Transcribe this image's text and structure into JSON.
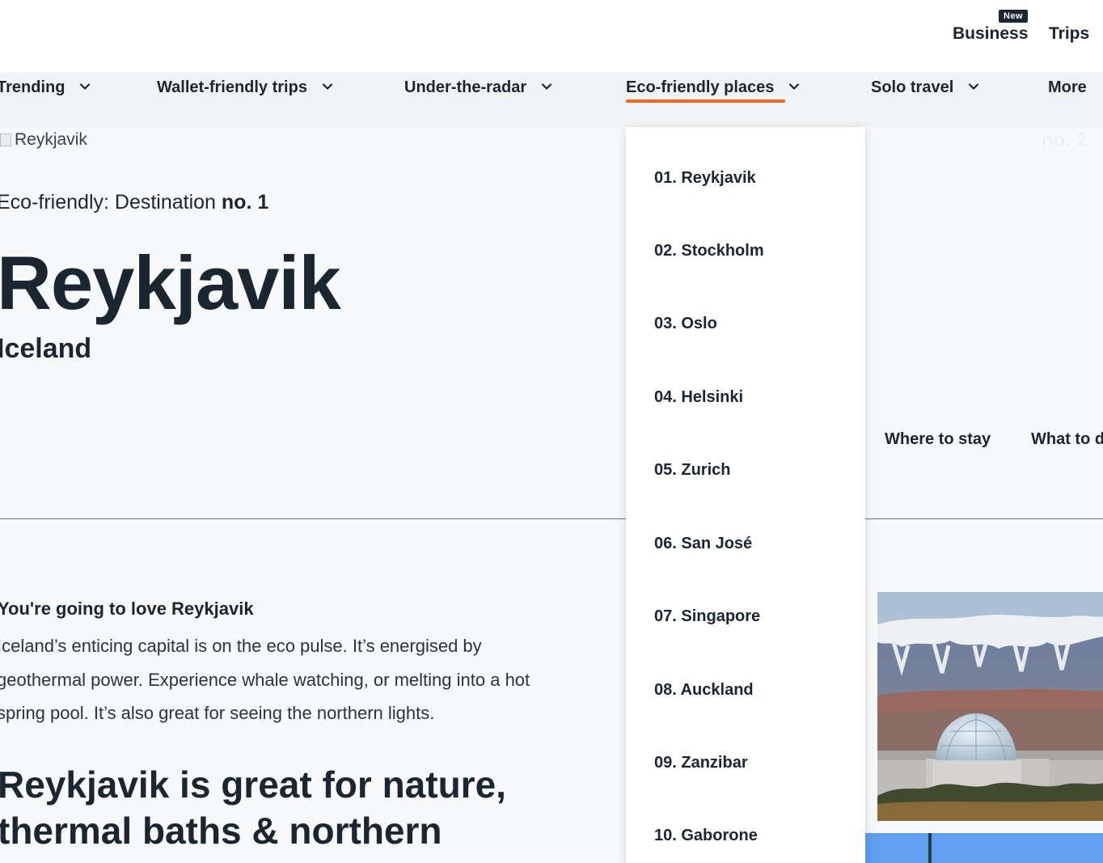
{
  "header": {
    "new_badge": "New",
    "business": "Business",
    "trips": "Trips"
  },
  "nav": {
    "items": [
      {
        "label": "Trending",
        "has_dropdown": true
      },
      {
        "label": "Wallet-friendly trips",
        "has_dropdown": true
      },
      {
        "label": "Under-the-radar",
        "has_dropdown": true
      },
      {
        "label": "Eco-friendly places",
        "has_dropdown": true,
        "active": true
      },
      {
        "label": "Solo travel",
        "has_dropdown": true
      },
      {
        "label": "More",
        "has_dropdown": false
      }
    ],
    "accent_color": "#f26722"
  },
  "dropdown": {
    "items": [
      "01. Reykjavik",
      "02. Stockholm",
      "03. Oslo",
      "04. Helsinki",
      "05. Zurich",
      "06. San José",
      "07. Singapore",
      "08. Auckland",
      "09. Zanzibar",
      "10. Gaborone"
    ]
  },
  "hero": {
    "image_alt": "Reykjavik",
    "eyebrow_prefix": "Eco-friendly: Destination ",
    "eyebrow_bold": "no. 1",
    "title": "Reykjavik",
    "subtitle": "Iceland",
    "next_label": "no. 2",
    "links": {
      "where_to_stay": "Where to stay",
      "what_to_do": "What to do"
    }
  },
  "content": {
    "love_title": "You're going to love Reykjavik",
    "love_text": "Iceland’s enticing capital is on the eco pulse. It’s energised by geothermal power. Experience whale watching, or melting into a hot spring pool. It’s also great for seeing the northern lights.",
    "great_title": "Reykjavik is great for nature, thermal baths & northern"
  },
  "colors": {
    "text": "#1b2631",
    "background": "#f8f9fb",
    "nav_background": "#f2f3f5",
    "accent": "#f26722"
  }
}
